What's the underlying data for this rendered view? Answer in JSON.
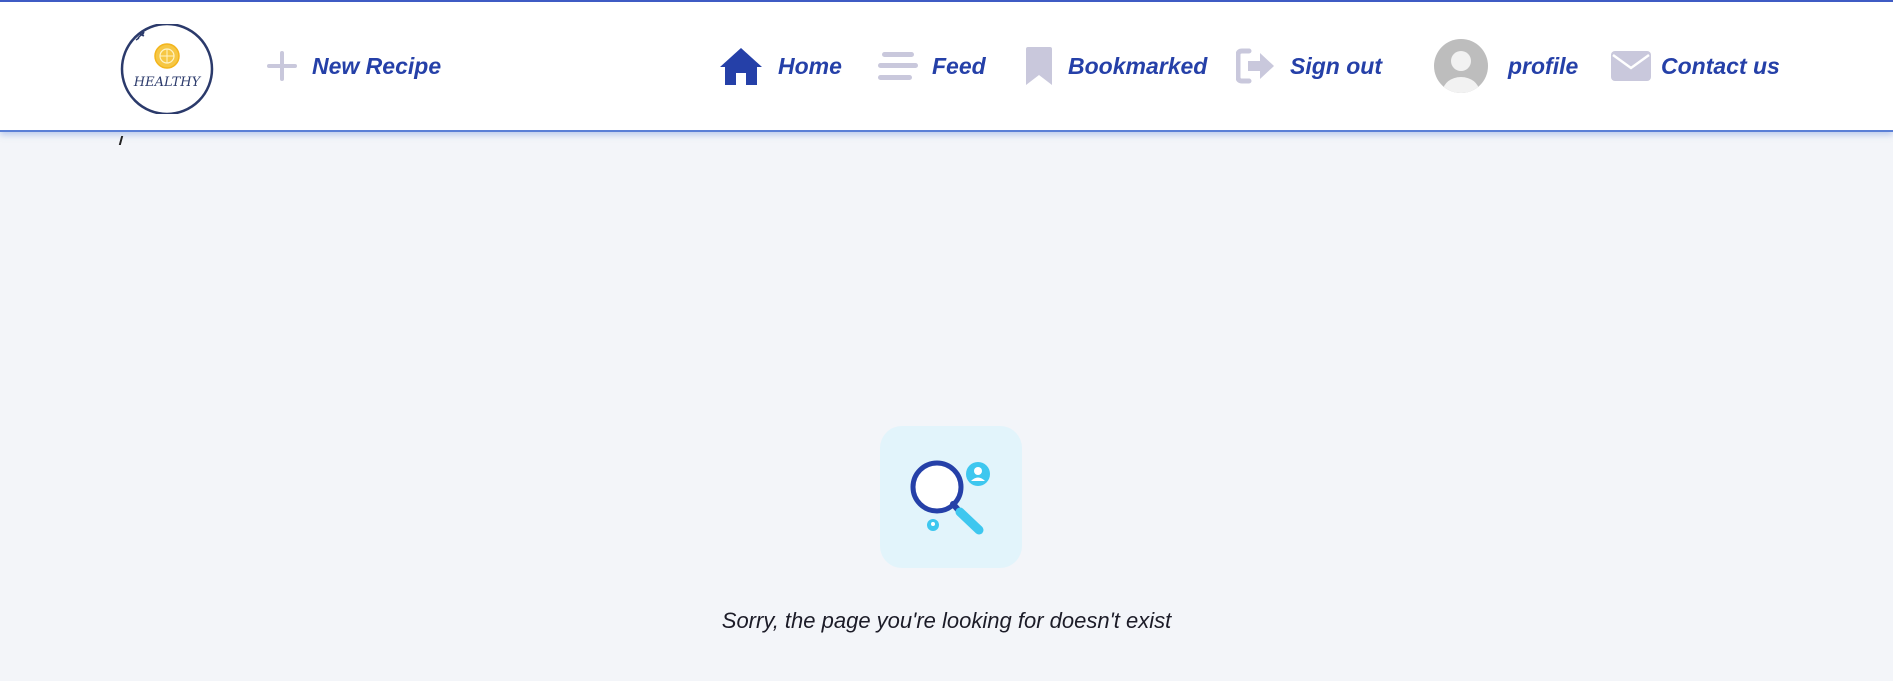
{
  "logo": {
    "text": "HEALTHY"
  },
  "nav": {
    "new_recipe": "New Recipe",
    "home": "Home",
    "feed": "Feed",
    "bookmarked": "Bookmarked",
    "sign_out": "Sign out",
    "profile": "profile",
    "contact": "Contact us"
  },
  "icons": {
    "new_recipe": "plus-icon",
    "home": "home-icon",
    "feed": "menu-lines-icon",
    "bookmarked": "bookmark-icon",
    "sign_out": "sign-out-icon",
    "profile": "avatar-icon",
    "contact": "envelope-icon",
    "illustration": "search-magnifier-icon"
  },
  "colors": {
    "accent": "#2540a8",
    "icon_muted": "#c9c8dc",
    "background": "#f3f5f9",
    "illustration_bg": "#e2f4fb"
  },
  "main": {
    "not_found_message": "Sorry, the page you're looking for doesn't exist"
  }
}
